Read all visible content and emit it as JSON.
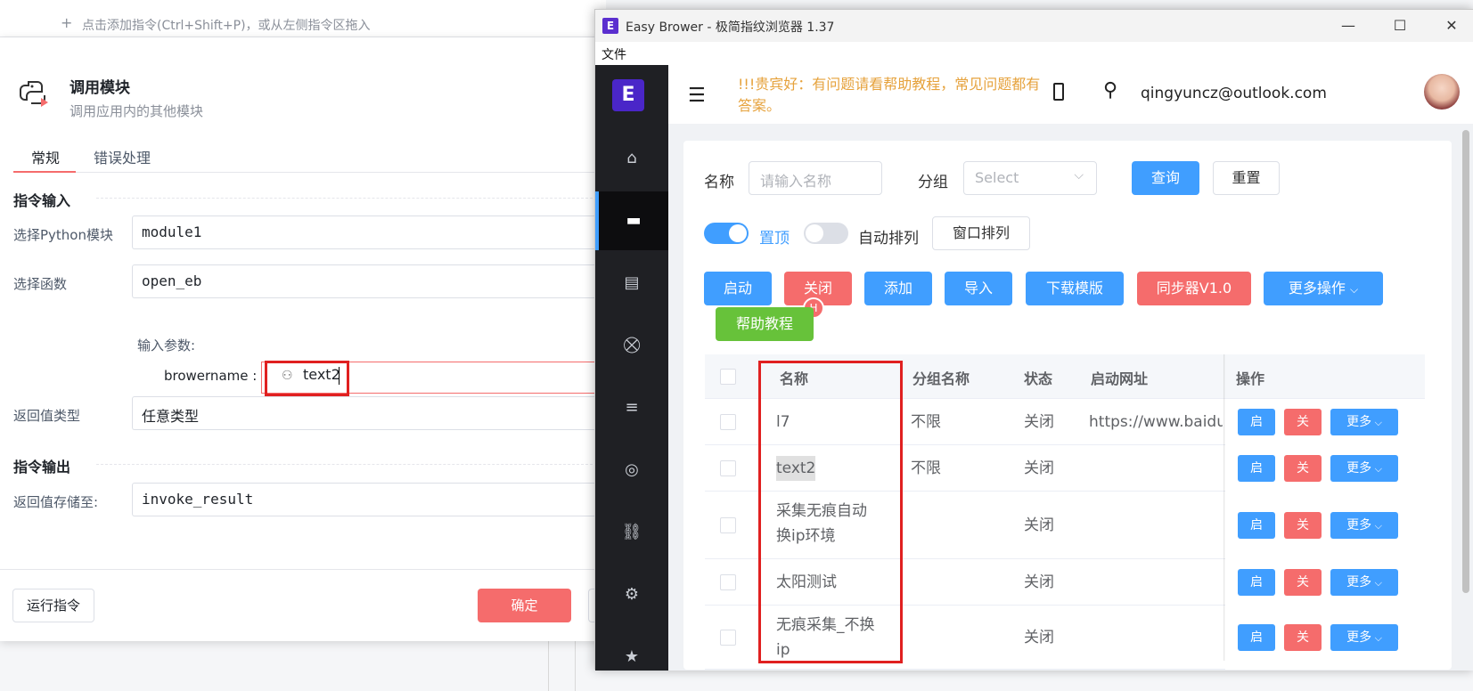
{
  "background": {
    "toolbar_hint": "点击添加指令(Ctrl+Shift+P)，或从左侧指令区拖入",
    "plus_glyph": "+"
  },
  "dialog": {
    "title": "调用模块",
    "subtitle": "调用应用内的其他模块",
    "tabs": [
      "常规",
      "错误处理"
    ],
    "input_section": "指令输入",
    "output_section": "指令输出",
    "fields": {
      "module_label": "选择Python模块",
      "module_value": "module1",
      "function_label": "选择函数",
      "function_value": "open_eb",
      "params_label": "输入参数:",
      "param_name": "browername :",
      "param_value": "text2",
      "return_type_label": "返回值类型",
      "return_type_value": "任意类型",
      "store_label": "返回值存储至:",
      "store_value": "invoke_result"
    },
    "run_button": "运行指令",
    "ok_button": "确定"
  },
  "window": {
    "title": "Easy Brower - 极简指纹浏览器 1.37",
    "logo_letter": "E",
    "menu": [
      "文件"
    ],
    "controls": {
      "minimize": "—",
      "maximize": "☐",
      "close": "✕"
    }
  },
  "app": {
    "notice": "!!!贵宾好：有问题请看帮助教程，常见问题都有答案。",
    "user_email": "qingyuncz@outlook.com",
    "nav_logo": "E",
    "nav_icons": [
      "home-icon",
      "monitor-icon",
      "document-icon",
      "cart-icon",
      "list-icon",
      "target-icon",
      "link-icon",
      "settings-icon",
      "star-icon"
    ],
    "nav_glyphs": [
      "⌂",
      "▬",
      "▤",
      "⛒",
      "≡",
      "◎",
      "⛓",
      "⚙",
      "★"
    ],
    "active_nav_index": 1,
    "query": {
      "name_label": "名称",
      "name_placeholder": "请输入名称",
      "group_label": "分组",
      "group_placeholder": "Select",
      "search_button": "查询",
      "reset_button": "重置"
    },
    "switches": {
      "pin_label": "置顶",
      "pin_on": true,
      "auto_arrange_label": "自动排列",
      "auto_arrange_on": false,
      "window_arrange_button": "窗口排列"
    },
    "actions": {
      "start": "启动",
      "close": "关闭",
      "add": "添加",
      "import": "导入",
      "download_template": "下载模版",
      "sync": "同步器V1.0",
      "more_ops": "更多操作",
      "help": "帮助教程",
      "badge": "H"
    },
    "table": {
      "headers": [
        "名称",
        "分组名称",
        "状态",
        "启动网址",
        "操作"
      ],
      "rows": [
        {
          "name": "l7",
          "group": "不限",
          "status": "关闭",
          "url": "https://www.baidu"
        },
        {
          "name": "text2",
          "group": "不限",
          "status": "关闭",
          "url": ""
        },
        {
          "name": "采集无痕自动换ip环境",
          "group": "",
          "status": "关闭",
          "url": ""
        },
        {
          "name": "太阳测试",
          "group": "",
          "status": "关闭",
          "url": ""
        },
        {
          "name": "无痕采集_不换ip",
          "group": "",
          "status": "关闭",
          "url": ""
        }
      ],
      "row_buttons": {
        "start": "启",
        "close": "关",
        "more": "更多"
      }
    }
  },
  "colors": {
    "primary_blue": "#409eff",
    "danger_red": "#f56c6c",
    "success_green": "#67c23a",
    "highlight_red": "#e02020",
    "notice_orange": "#e6a23c",
    "sidebar_dark": "#1f2024"
  }
}
